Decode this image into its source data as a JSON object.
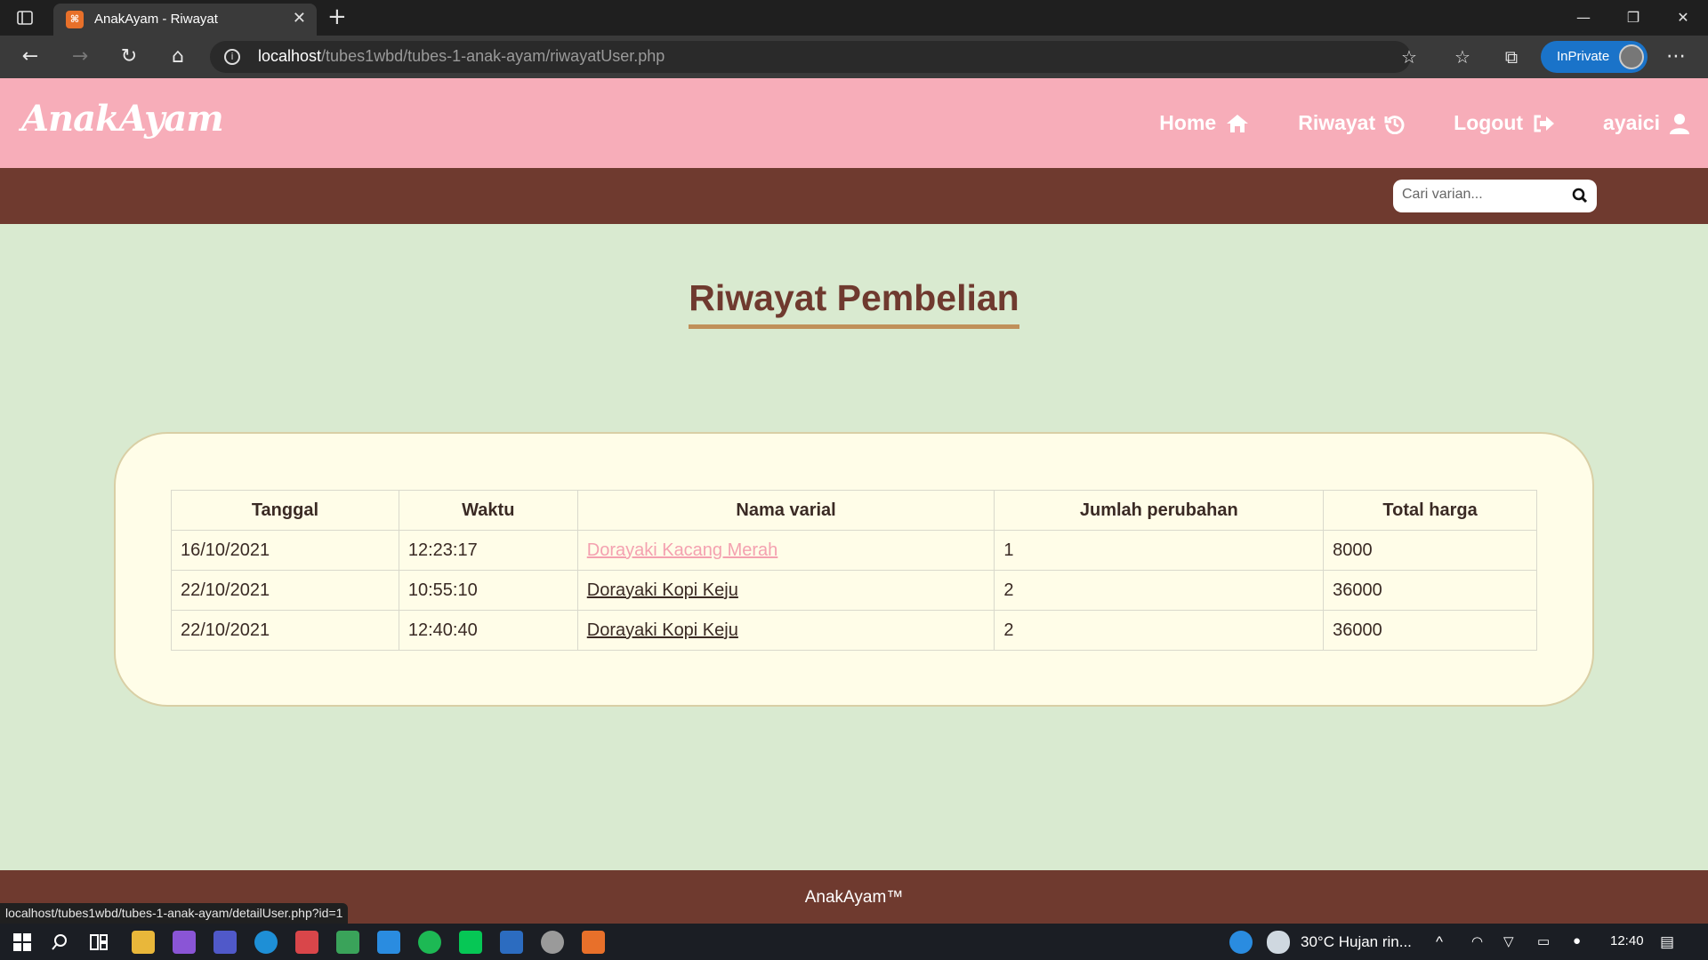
{
  "browser": {
    "tab_title": "AnakAyam - Riwayat",
    "url_host": "localhost",
    "url_path": "/tubes1wbd/tubes-1-anak-ayam/riwayatUser.php",
    "inprivate_label": "InPrivate",
    "status_url": "localhost/tubes1wbd/tubes-1-anak-ayam/detailUser.php?id=1"
  },
  "header": {
    "brand": "AnakAyam",
    "nav": [
      {
        "label": "Home",
        "icon": "home-icon"
      },
      {
        "label": "Riwayat",
        "icon": "history-icon"
      },
      {
        "label": "Logout",
        "icon": "logout-icon"
      },
      {
        "label": "ayaici",
        "icon": "user-icon"
      }
    ]
  },
  "search": {
    "placeholder": "Cari varian..."
  },
  "main": {
    "title": "Riwayat Pembelian",
    "table": {
      "columns": [
        "Tanggal",
        "Waktu",
        "Nama varial",
        "Jumlah perubahan",
        "Total harga"
      ],
      "rows": [
        {
          "tanggal": "16/10/2021",
          "waktu": "12:23:17",
          "nama": "Dorayaki Kacang Merah",
          "jumlah": "1",
          "total": "8000"
        },
        {
          "tanggal": "22/10/2021",
          "waktu": "10:55:10",
          "nama": "Dorayaki Kopi Keju",
          "jumlah": "2",
          "total": "36000"
        },
        {
          "tanggal": "22/10/2021",
          "waktu": "12:40:40",
          "nama": "Dorayaki Kopi Keju",
          "jumlah": "2",
          "total": "36000"
        }
      ]
    }
  },
  "footer": {
    "text": "AnakAyam™"
  },
  "taskbar": {
    "weather": "30°C  Hujan rin...",
    "clock": "12:40"
  },
  "colors": {
    "header_pink": "#f7adb9",
    "brown": "#6f3a2f",
    "page_bg": "#d9ead0",
    "card_bg": "#fffde8",
    "link_hover": "#f4a1b0"
  }
}
